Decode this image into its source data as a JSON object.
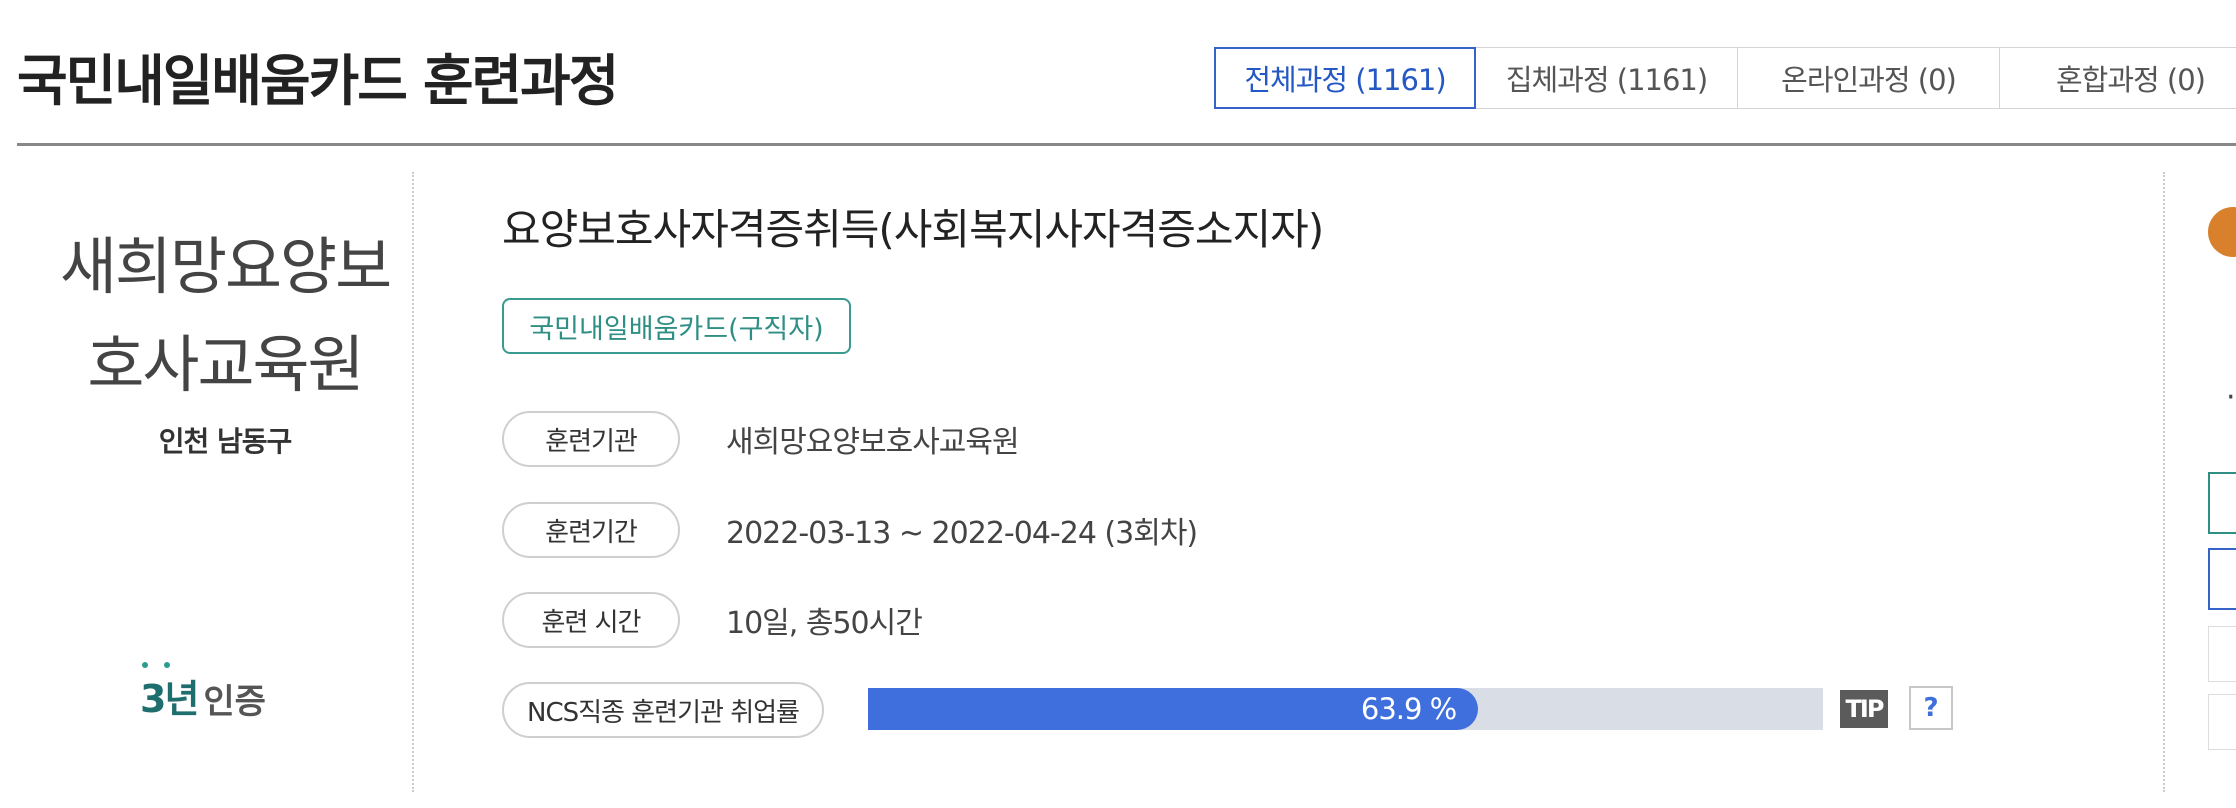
{
  "header": {
    "title": "국민내일배움카드 훈련과정",
    "tabs": [
      {
        "label": "전체과정 (1161)",
        "active": true
      },
      {
        "label": "집체과정 (1161)",
        "active": false
      },
      {
        "label": "온라인과정 (0)",
        "active": false
      },
      {
        "label": "혼합과정 (0)",
        "active": false
      }
    ]
  },
  "institution": {
    "name": "새희망요양보호사교육원",
    "location": "인천 남동구",
    "cert_badge": "3년",
    "cert_label": "인증"
  },
  "course": {
    "title": "요양보호사자격증취득(사회복지사자격증소지자)",
    "card_tag": "국민내일배움카드(구직자)",
    "rows": [
      {
        "label": "훈련기관",
        "value": "새희망요양보호사교육원"
      },
      {
        "label": "훈련기간",
        "value": "2022-03-13 ~ 2022-04-24 (3회차)"
      },
      {
        "label": "훈련 시간",
        "value": "10일, 총50시간"
      }
    ],
    "employment": {
      "label": "NCS직종 훈련기관 취업률",
      "rate_text": "63.9 %",
      "rate_percent": 63.9,
      "tip_label": "TIP",
      "help_label": "?"
    }
  },
  "colors": {
    "accent_blue": "#3f6fdc",
    "tab_active": "#2458c4",
    "teal": "#2f8f84",
    "bar_track": "#d8dde6",
    "orange": "#d8802c"
  },
  "right_panel": {
    "partial_glyph": "·"
  }
}
